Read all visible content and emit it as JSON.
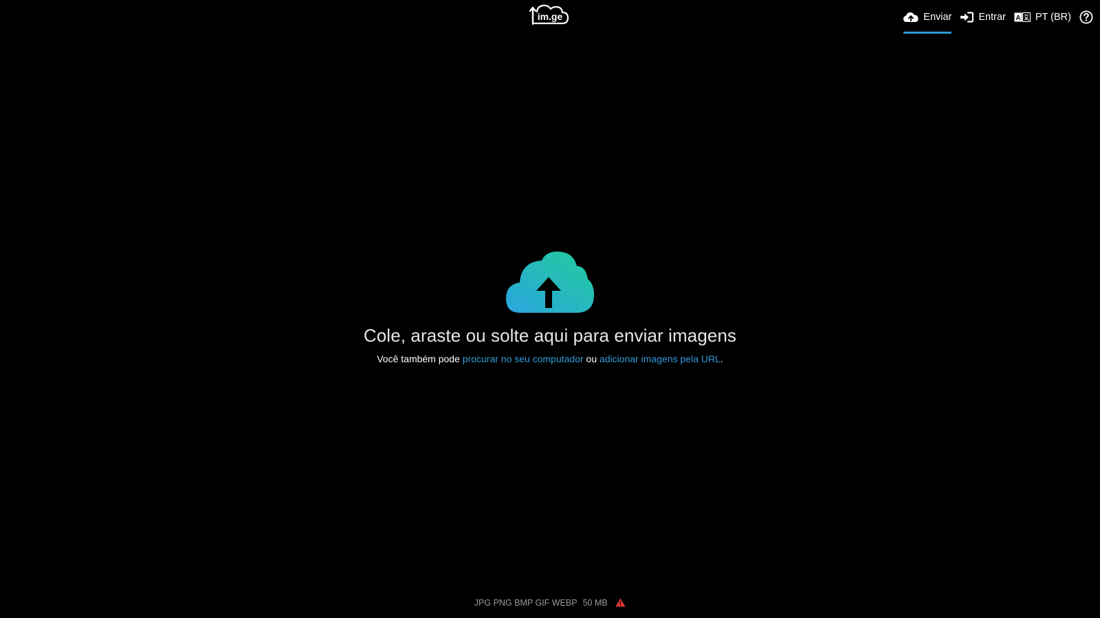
{
  "header": {
    "logo_text": "im.ge",
    "nav": [
      {
        "label": "Enviar",
        "icon": "cloud-upload-icon",
        "active": true
      },
      {
        "label": "Entrar",
        "icon": "sign-in-icon",
        "active": false
      },
      {
        "label": "PT (BR)",
        "icon": "language-icon",
        "active": false
      }
    ],
    "help_icon": "help-circle-icon"
  },
  "main": {
    "headline": "Cole, araste ou solte aqui para enviar imagens",
    "sub_prefix": "Você também pode ",
    "browse_link": "procurar no seu computador",
    "sub_mid": " ou ",
    "url_link": "adicionar imagens pela URL",
    "sub_suffix": "."
  },
  "footer": {
    "formats": "JPG PNG BMP GIF WEBP",
    "max_size": "50 MB",
    "warning_icon": "warning-triangle-icon"
  },
  "colors": {
    "accent": "#2f9bd6",
    "gradient_start": "#2aa5e0",
    "gradient_end": "#22cc9a",
    "warning": "#e53935"
  }
}
